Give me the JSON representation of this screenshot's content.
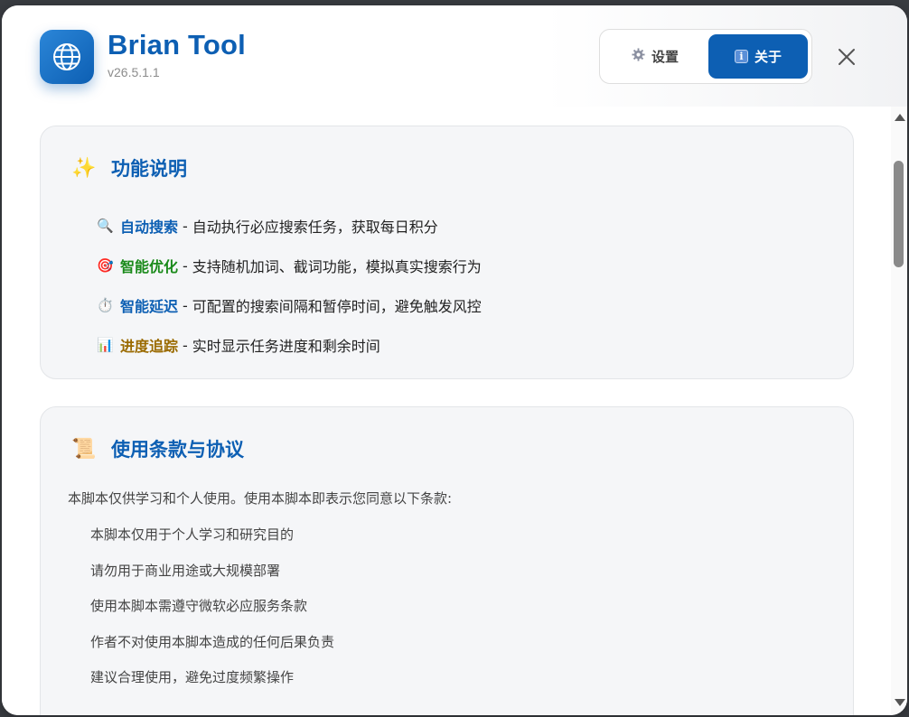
{
  "header": {
    "app_icon": "globe-icon",
    "title": "Brian Tool",
    "version": "v26.5.1.1"
  },
  "tabs": [
    {
      "label": "设置",
      "icon": "gear-icon",
      "active": false
    },
    {
      "label": "关于",
      "icon": "info-icon",
      "active": true
    }
  ],
  "features": {
    "emoji": "✨",
    "title": "功能说明",
    "items": [
      {
        "icon": "🔍",
        "icon_name": "magnifier-icon",
        "name": "自动搜索",
        "name_color": "#0d5fb3",
        "sep": "-",
        "desc": "自动执行必应搜索任务，获取每日积分"
      },
      {
        "icon": "🎯",
        "icon_name": "target-icon",
        "name": "智能优化",
        "name_color": "#1a8a1a",
        "sep": "-",
        "desc": "支持随机加词、截词功能，模拟真实搜索行为"
      },
      {
        "icon": "⏱️",
        "icon_name": "stopwatch-icon",
        "name": "智能延迟",
        "name_color": "#0d5fb3",
        "sep": "-",
        "desc": "可配置的搜索间隔和暂停时间，避免触发风控"
      },
      {
        "icon": "📊",
        "icon_name": "bar-chart-icon",
        "name": "进度追踪",
        "name_color": "#9a6a00",
        "sep": "-",
        "desc": "实时显示任务进度和剩余时间"
      }
    ]
  },
  "terms": {
    "emoji": "📜",
    "title": "使用条款与协议",
    "intro": "本脚本仅供学习和个人使用。使用本脚本即表示您同意以下条款:",
    "items": [
      "本脚本仅用于个人学习和研究目的",
      "请勿用于商业用途或大规模部署",
      "使用本脚本需遵守微软必应服务条款",
      "作者不对使用本脚本造成的任何后果负责",
      "建议合理使用，避免过度频繁操作"
    ]
  },
  "colors": {
    "accent": "#0d5fb3"
  }
}
